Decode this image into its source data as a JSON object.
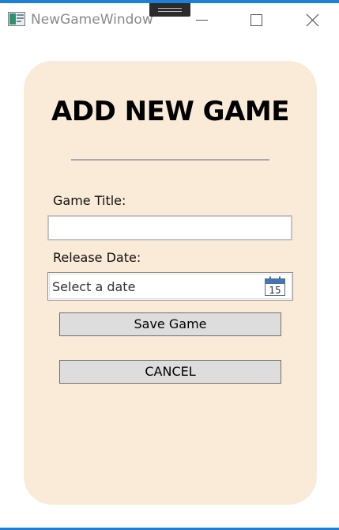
{
  "window": {
    "title": "NewGameWindow"
  },
  "form": {
    "heading": "ADD NEW GAME",
    "title_label": "Game Title:",
    "title_value": "",
    "date_label": "Release Date:",
    "date_placeholder": "Select a date",
    "calendar_day": "15",
    "save_label": "Save Game",
    "cancel_label": "CANCEL"
  },
  "colors": {
    "card_background": "#faead8",
    "accent": "#1e7fd6",
    "button_background": "#dddddd"
  }
}
